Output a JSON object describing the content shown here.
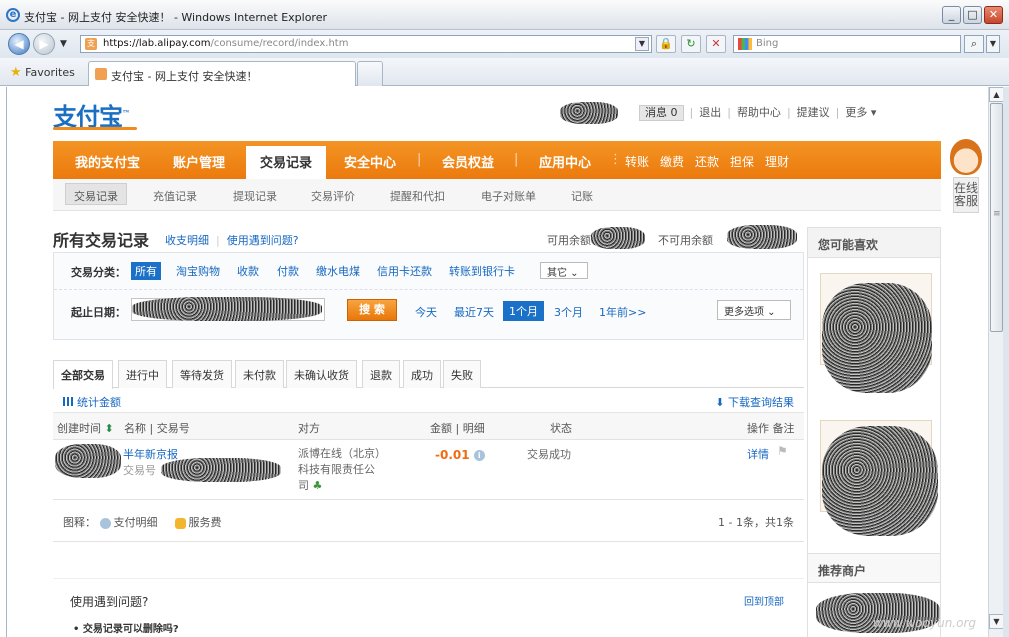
{
  "window": {
    "title": "支付宝 - 网上支付 安全快速！ - Windows Internet Explorer",
    "controls": [
      "_",
      "□",
      "✕"
    ]
  },
  "browser": {
    "url_host": "https://lab.alipay.com",
    "url_path": "/consume/record/index.htm",
    "search_placeholder": "Bing",
    "favorites_label": "Favorites",
    "tab_title": "支付宝 - 网上支付 安全快速！"
  },
  "header": {
    "logo_text": "支付宝",
    "logo_tm": "™",
    "links": {
      "messages": "消息 0",
      "logout": "退出",
      "help": "帮助中心",
      "suggest": "提建议",
      "more": "更多 ▾"
    }
  },
  "main_nav": {
    "items": [
      "我的支付宝",
      "账户管理",
      "交易记录",
      "安全中心",
      "会员权益",
      "应用中心"
    ],
    "active": "交易记录",
    "quick": [
      "转账",
      "缴费",
      "还款",
      "担保",
      "理财"
    ]
  },
  "sub_nav": {
    "items": [
      "交易记录",
      "充值记录",
      "提现记录",
      "交易评价",
      "提醒和代扣",
      "电子对账单",
      "记账"
    ],
    "active": "交易记录"
  },
  "support": {
    "label": "在线客服"
  },
  "page": {
    "title": "所有交易记录",
    "links": [
      "收支明细",
      "使用遇到问题?"
    ],
    "available_balance_label": "可用余额",
    "unavailable_balance_label": "不可用余额"
  },
  "filters": {
    "category_label": "交易分类：",
    "categories": [
      "所有",
      "淘宝购物",
      "收款",
      "付款",
      "缴水电煤",
      "信用卡还款",
      "转账到银行卡"
    ],
    "active_category": "所有",
    "other_select": "其它",
    "date_label": "起止日期：",
    "search_button": "搜 索",
    "ranges": [
      "今天",
      "最近7天",
      "1个月",
      "3个月",
      "1年前>>"
    ],
    "active_range": "1个月",
    "more_options": "更多选项"
  },
  "tabs": {
    "items": [
      "全部交易",
      "进行中",
      "等待发货",
      "未付款",
      "未确认收货",
      "退款",
      "成功",
      "失败"
    ],
    "active": "全部交易"
  },
  "toolbar": {
    "stats_link": "统计金额",
    "download_link": "下载查询结果"
  },
  "table": {
    "headers": {
      "created": "创建时间",
      "name": "名称 | 交易号",
      "party": "对方",
      "amount": "金额 | 明细",
      "status": "状态",
      "actions": "操作 备注"
    },
    "rows": [
      {
        "name": "半年新京报",
        "txn_label": "交易号",
        "party": "派博在线（北京）科技有限责任公司",
        "amount": "-0.01",
        "status": "交易成功",
        "action": "详情"
      }
    ]
  },
  "legend": {
    "label": "图释：",
    "items": [
      "支付明细",
      "服务费"
    ],
    "pager": "1 - 1条，共1条"
  },
  "help": {
    "title": "使用遇到问题?",
    "back_to_top": "回到顶部",
    "faq_first": "• 交易记录可以删除吗?"
  },
  "sidebar": {
    "title": "您可能喜欢",
    "title2": "推荐商户"
  },
  "watermark": "www.wooyun.org"
}
